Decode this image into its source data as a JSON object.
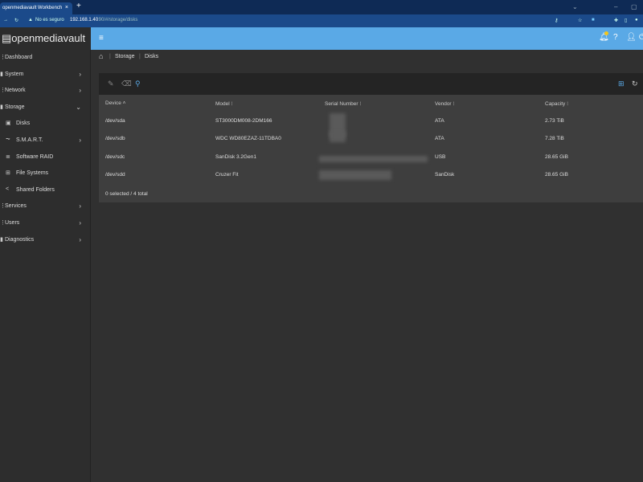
{
  "browser": {
    "tab_title": "openmediavault Workbench",
    "close": "×",
    "new_tab": "+",
    "security": "No es seguro",
    "url_host": "192.168.1.40",
    "url_rest": ":90/#/storage/disks"
  },
  "app": {
    "logo": "openmediavault",
    "menu_icon": "≡"
  },
  "breadcrumb": [
    "Storage",
    "Disks"
  ],
  "sidebar": {
    "items": [
      {
        "label": "Dashboard",
        "icon": "⋮",
        "chev": ""
      },
      {
        "label": "System",
        "icon": "▮",
        "chev": "›"
      },
      {
        "label": "Network",
        "icon": "⋮",
        "chev": "›"
      },
      {
        "label": "Storage",
        "icon": "▮",
        "chev": "⌄"
      },
      {
        "label": "Disks",
        "icon": "▣",
        "chev": "",
        "sub": true
      },
      {
        "label": "S.M.A.R.T.",
        "icon": "⏦",
        "chev": "›",
        "sub": true
      },
      {
        "label": "Software RAID",
        "icon": "≣",
        "chev": "",
        "sub": true
      },
      {
        "label": "File Systems",
        "icon": "⊞",
        "chev": "",
        "sub": true
      },
      {
        "label": "Shared Folders",
        "icon": "<",
        "chev": "",
        "sub": true
      },
      {
        "label": "Services",
        "icon": "⋮",
        "chev": "›"
      },
      {
        "label": "Users",
        "icon": "⋮",
        "chev": "›"
      },
      {
        "label": "Diagnostics",
        "icon": "▮",
        "chev": "›"
      }
    ]
  },
  "table": {
    "columns": [
      "Device ˄",
      "Model ⁝",
      "Serial Number ⁝",
      "Vendor ⁝",
      "Capacity ⁝"
    ],
    "rows": [
      {
        "device": "/dev/sda",
        "model": "ST3000DM008-2DM166",
        "vendor": "ATA",
        "capacity": "2.73 TiB"
      },
      {
        "device": "/dev/sdb",
        "model": "WDC WD80EZAZ-11TDBA0",
        "vendor": "ATA",
        "capacity": "7.28 TiB"
      },
      {
        "device": "/dev/sdc",
        "model": "SanDisk 3.2Gen1",
        "vendor": "USB",
        "capacity": "28.65 GiB"
      },
      {
        "device": "/dev/sdd",
        "model": "Cruzer Fit",
        "vendor": "SanDisk",
        "capacity": "28.65 GiB"
      }
    ],
    "footer": "0 selected / 4 total"
  }
}
